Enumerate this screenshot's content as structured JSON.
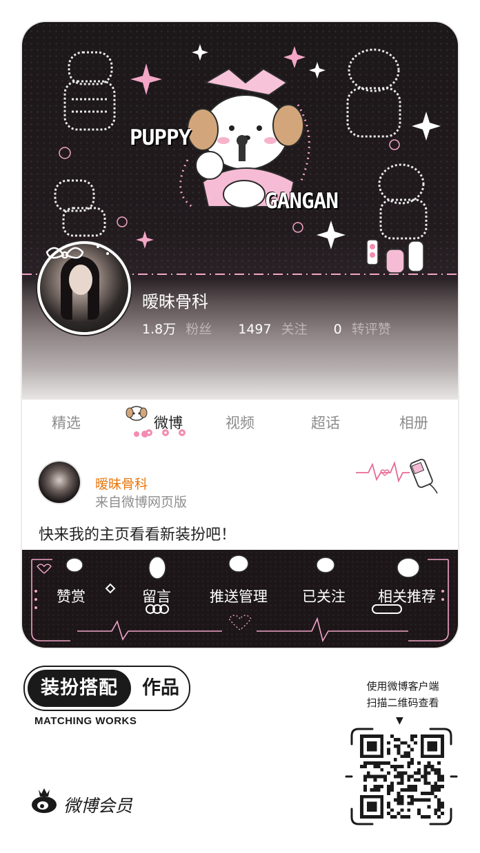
{
  "banner": {
    "title_left": "PUPPY",
    "title_right": "GANGAN"
  },
  "profile": {
    "name": "暧昧骨科",
    "followers_num": "1.8万",
    "followers_label": "粉丝",
    "following_num": "1497",
    "following_label": "关注",
    "likes_num": "0",
    "likes_label": "转评赞"
  },
  "tabs": [
    {
      "label": "精选"
    },
    {
      "label": "微博"
    },
    {
      "label": "视频"
    },
    {
      "label": "超话"
    },
    {
      "label": "相册"
    }
  ],
  "post": {
    "author": "暧昧骨科",
    "source": "来自微博网页版",
    "text": "快来我的主页看看新装扮吧！"
  },
  "actions": [
    {
      "label": "赞赏"
    },
    {
      "label": "留言"
    },
    {
      "label": "推送管理"
    },
    {
      "label": "已关注"
    },
    {
      "label": "相关推荐"
    }
  ],
  "footer": {
    "badge_dark": "装扮搭配",
    "badge_light": "作品",
    "subtitle": "MATCHING WORKS",
    "brand": "微博会员",
    "qr_hint_line1": "使用微博客户端",
    "qr_hint_line2": "扫描二维码查看"
  },
  "colors": {
    "author_name": "#e8760c",
    "accent_pink": "#f2a6c8",
    "banner_dark": "#1c1719"
  }
}
